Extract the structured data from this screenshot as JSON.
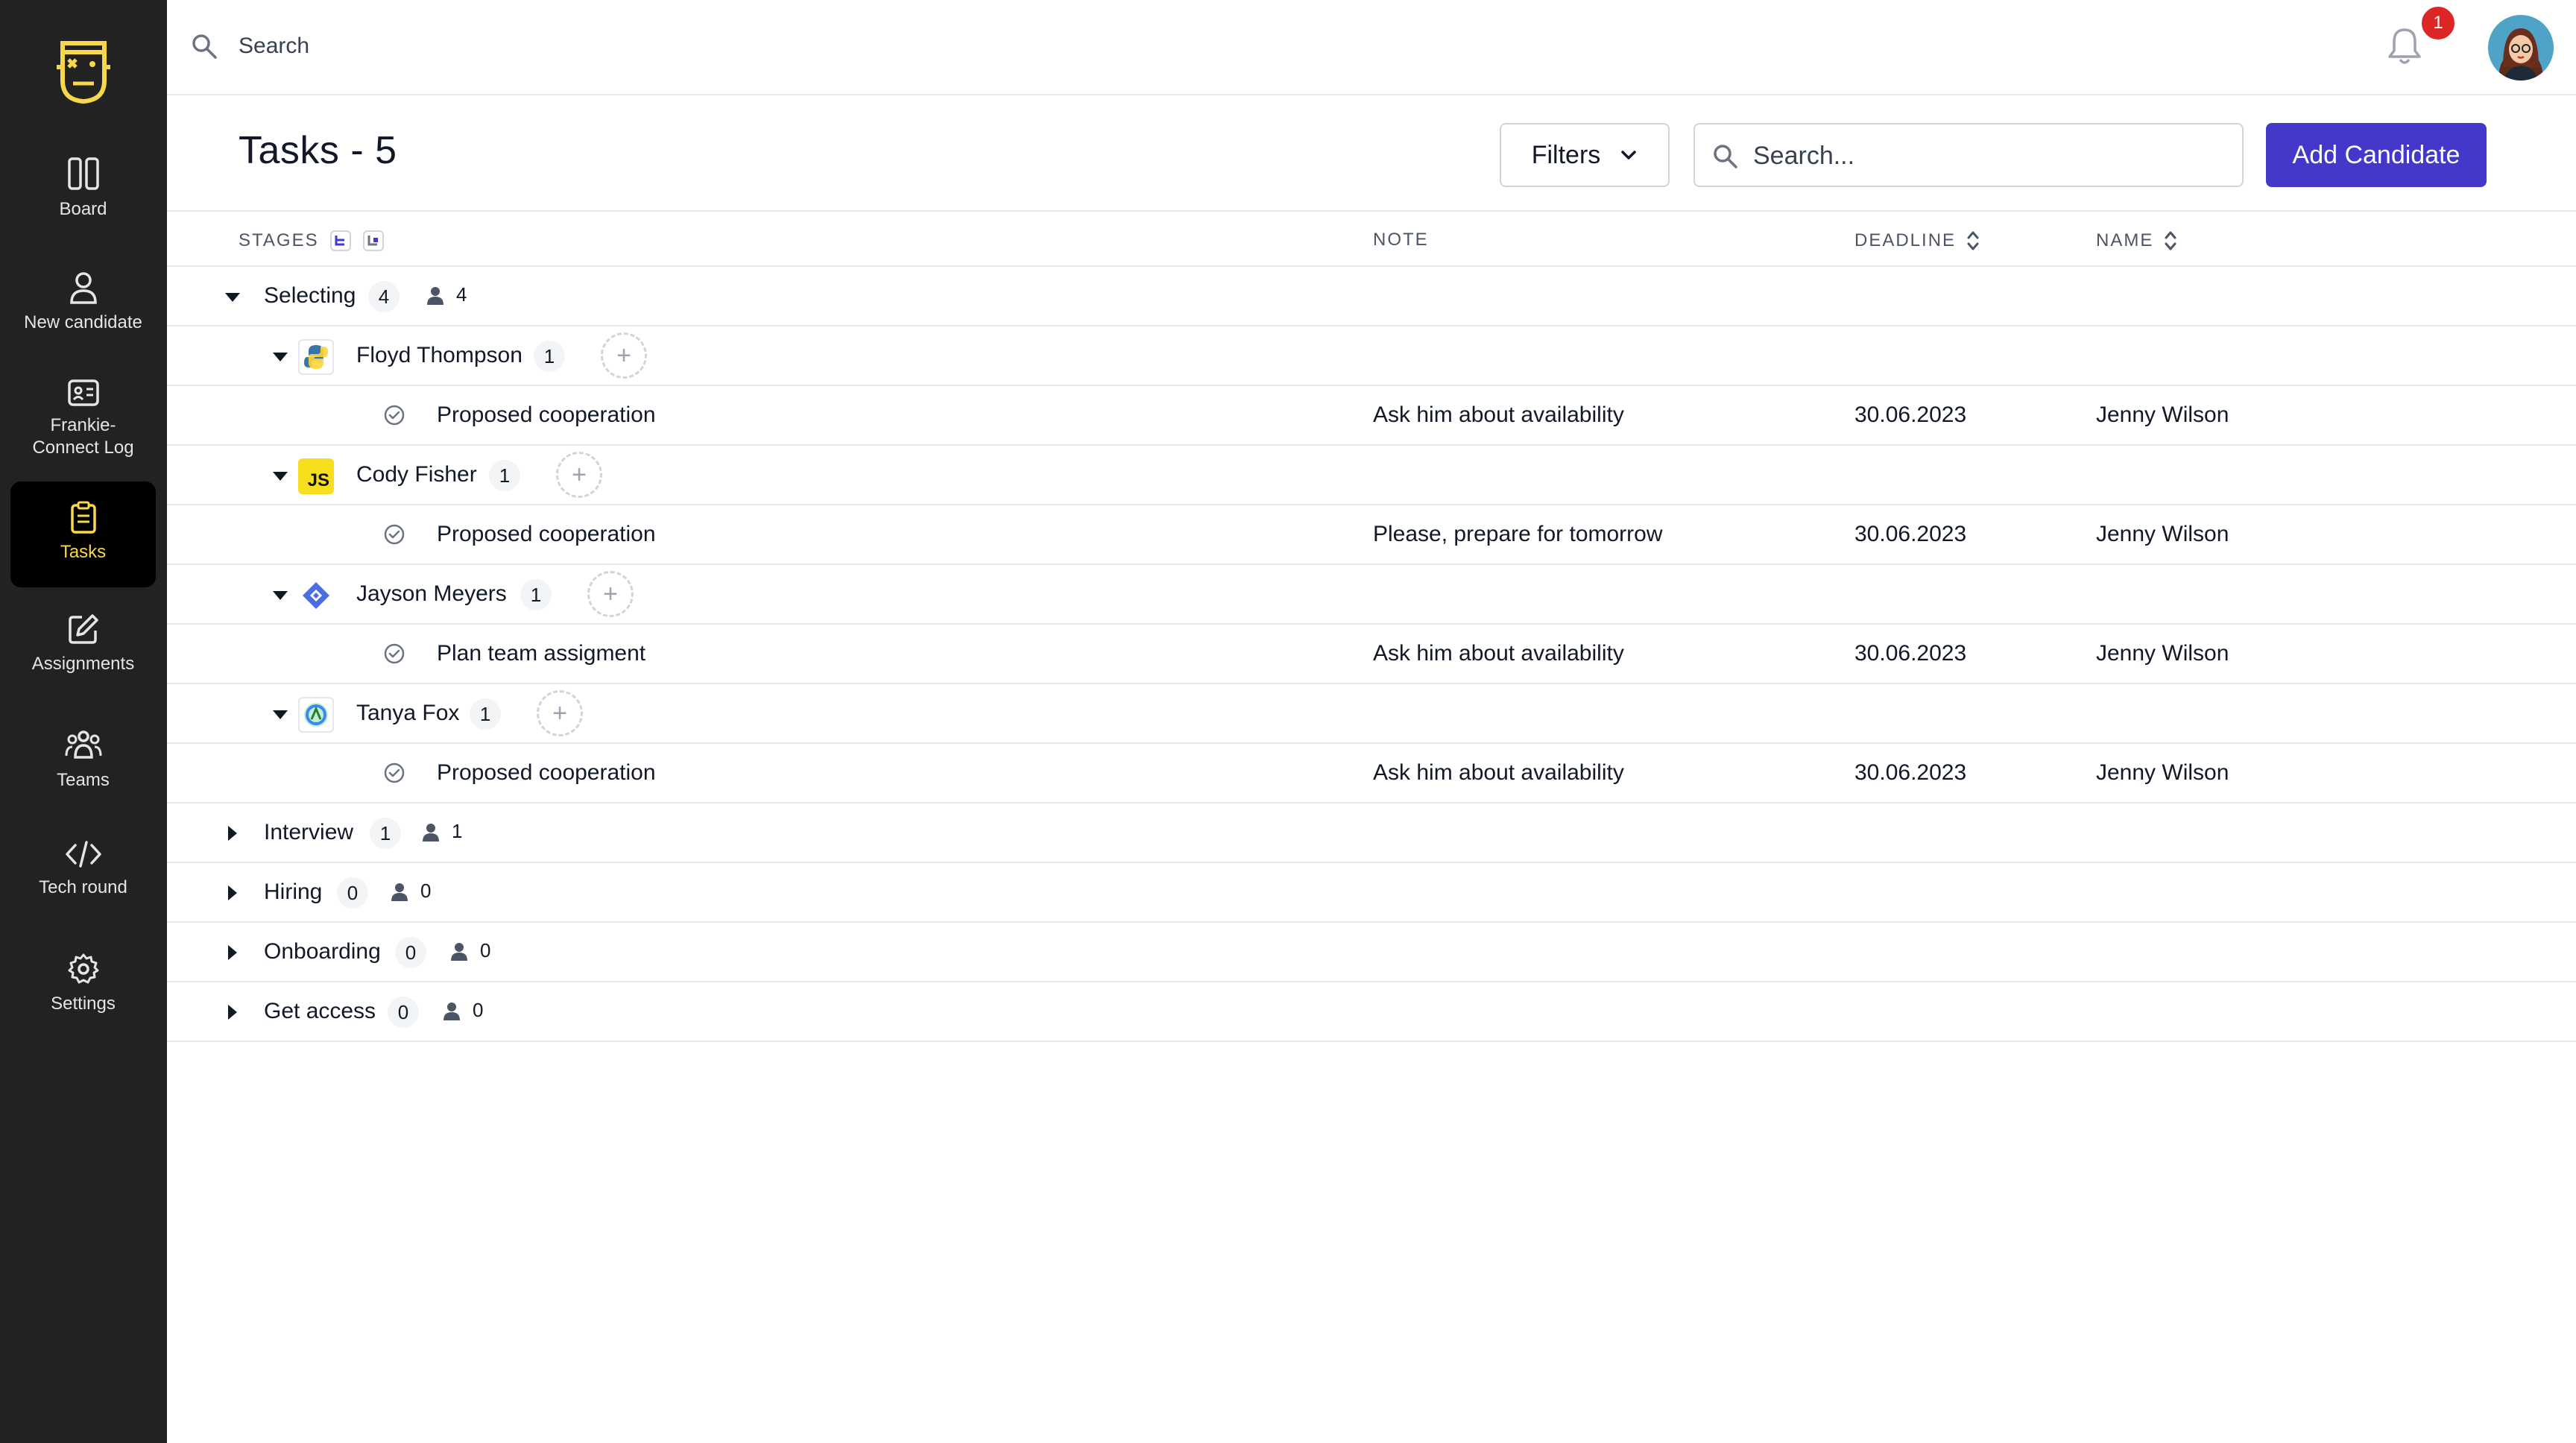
{
  "sidebar": {
    "items": [
      {
        "label": "Board",
        "icon": "board-icon"
      },
      {
        "label": "New candidate",
        "icon": "person-icon"
      },
      {
        "label": "Frankie-\nConnect Log",
        "label_line1": "Frankie-",
        "label_line2": "Connect Log",
        "icon": "id-card-icon"
      },
      {
        "label": "Tasks",
        "icon": "clipboard-icon",
        "active": true
      },
      {
        "label": "Assignments",
        "icon": "edit-icon"
      },
      {
        "label": "Teams",
        "icon": "teams-icon"
      },
      {
        "label": "Tech round",
        "icon": "code-icon"
      },
      {
        "label": "Settings",
        "icon": "gear-icon"
      }
    ]
  },
  "topbar": {
    "search_placeholder": "Search",
    "notifications_count": "1"
  },
  "header": {
    "title": "Tasks - 5",
    "filters_label": "Filters",
    "search_placeholder": "Search...",
    "add_label": "Add Candidate"
  },
  "table": {
    "headers": {
      "stages": "STAGES",
      "note": "NOTE",
      "deadline": "DEADLINE",
      "name": "NAME"
    },
    "stages": [
      {
        "name": "Selecting",
        "count": "4",
        "people": "4",
        "expanded": true,
        "candidates": [
          {
            "name": "Floyd Thompson",
            "count": "1",
            "logo": "python-logo",
            "task": {
              "title": "Proposed cooperation",
              "note": "Ask him about availability",
              "deadline": "30.06.2023",
              "assignee": "Jenny Wilson"
            }
          },
          {
            "name": "Cody Fisher",
            "count": "1",
            "logo": "javascript-logo",
            "logo_text": "JS",
            "task": {
              "title": "Proposed cooperation",
              "note": "Please, prepare for tomorrow",
              "deadline": "30.06.2023",
              "assignee": "Jenny Wilson"
            }
          },
          {
            "name": "Jayson Meyers",
            "count": "1",
            "logo": "jira-logo",
            "task": {
              "title": "Plan team assigment",
              "note": "Ask him about availability",
              "deadline": "30.06.2023",
              "assignee": "Jenny Wilson"
            }
          },
          {
            "name": "Tanya Fox",
            "count": "1",
            "logo": "android-studio-logo",
            "task": {
              "title": "Proposed cooperation",
              "note": "Ask him about availability",
              "deadline": "30.06.2023",
              "assignee": "Jenny Wilson"
            }
          }
        ]
      },
      {
        "name": "Interview",
        "count": "1",
        "people": "1",
        "expanded": false
      },
      {
        "name": "Hiring",
        "count": "0",
        "people": "0",
        "expanded": false
      },
      {
        "name": "Onboarding",
        "count": "0",
        "people": "0",
        "expanded": false
      },
      {
        "name": "Get access",
        "count": "0",
        "people": "0",
        "expanded": false
      }
    ]
  },
  "colors": {
    "sidebar_bg": "#222222",
    "active_accent": "#f8d84a",
    "primary": "#4338ca",
    "badge": "#dc2626"
  }
}
